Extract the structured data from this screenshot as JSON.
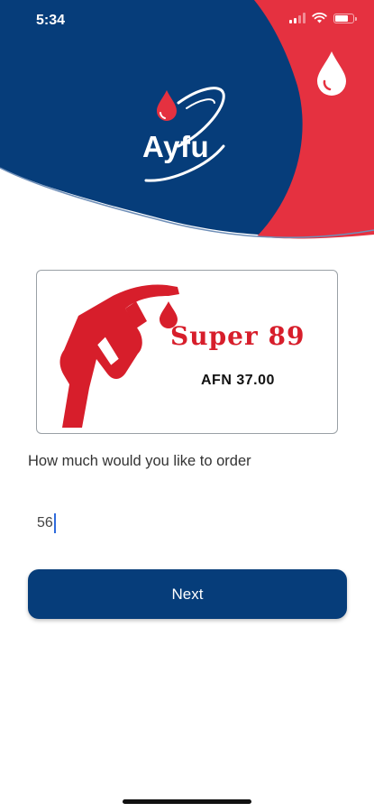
{
  "status_bar": {
    "time": "5:34",
    "signal_icon": "signal-bars-icon",
    "wifi_icon": "wifi-icon",
    "battery_icon": "battery-icon",
    "battery_level": 0.85
  },
  "brand": {
    "name": "Ayfu",
    "primary_color": "#063d7a",
    "accent_color": "#e53140"
  },
  "product": {
    "name": "Super 89",
    "price": "AFN 37.00",
    "icon": "fuel-pump-icon"
  },
  "order": {
    "prompt": "How much would you like to order",
    "quantity_value": "56"
  },
  "actions": {
    "next_label": "Next"
  }
}
